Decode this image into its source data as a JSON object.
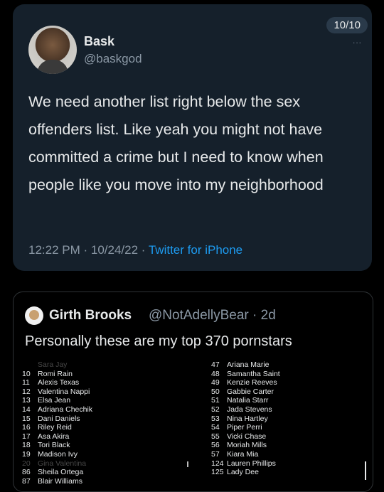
{
  "tweet1": {
    "page_counter": "10/10",
    "more_label": "...",
    "display_name": "Bask",
    "handle": "@baskgod",
    "body": "We need another list right below the sex offenders list. Like yeah you might not have committed a crime but I need to know when people like you move into my neighborhood",
    "timestamp": "12:22 PM · 10/24/22 · ",
    "source": "Twitter for iPhone"
  },
  "tweet2": {
    "display_name": "Girth Brooks",
    "handle_time": "@NotAdellyBear · 2d",
    "body": "Personally these are my top 370 pornstars",
    "list_left": [
      {
        "num": "",
        "name": "Sara Jay",
        "cut": true
      },
      {
        "num": "10",
        "name": "Romi Rain"
      },
      {
        "num": "11",
        "name": "Alexis Texas"
      },
      {
        "num": "12",
        "name": "Valentina Nappi"
      },
      {
        "num": "13",
        "name": "Elsa Jean"
      },
      {
        "num": "14",
        "name": "Adriana Chechik"
      },
      {
        "num": "15",
        "name": "Dani Daniels"
      },
      {
        "num": "16",
        "name": "Riley Reid"
      },
      {
        "num": "17",
        "name": "Asa Akira"
      },
      {
        "num": "18",
        "name": "Tori Black"
      },
      {
        "num": "19",
        "name": "Madison Ivy"
      },
      {
        "num": "20",
        "name": "Gina Valentina",
        "cut": true
      },
      {
        "num": "86",
        "name": "Sheila Ortega"
      },
      {
        "num": "87",
        "name": "Blair Williams"
      }
    ],
    "list_right": [
      {
        "num": "47",
        "name": "Ariana Marie"
      },
      {
        "num": "48",
        "name": "Samantha Saint"
      },
      {
        "num": "49",
        "name": "Kenzie Reeves"
      },
      {
        "num": "50",
        "name": "Gabbie Carter"
      },
      {
        "num": "51",
        "name": "Natalia Starr"
      },
      {
        "num": "52",
        "name": "Jada Stevens"
      },
      {
        "num": "53",
        "name": "Nina Hartley"
      },
      {
        "num": "54",
        "name": "Piper Perri"
      },
      {
        "num": "55",
        "name": "Vicki Chase"
      },
      {
        "num": "56",
        "name": "Moriah Mills"
      },
      {
        "num": "57",
        "name": "Kiara Mia"
      },
      {
        "num": "124",
        "name": "Lauren Phillips"
      },
      {
        "num": "125",
        "name": "Lady Dee"
      }
    ]
  }
}
